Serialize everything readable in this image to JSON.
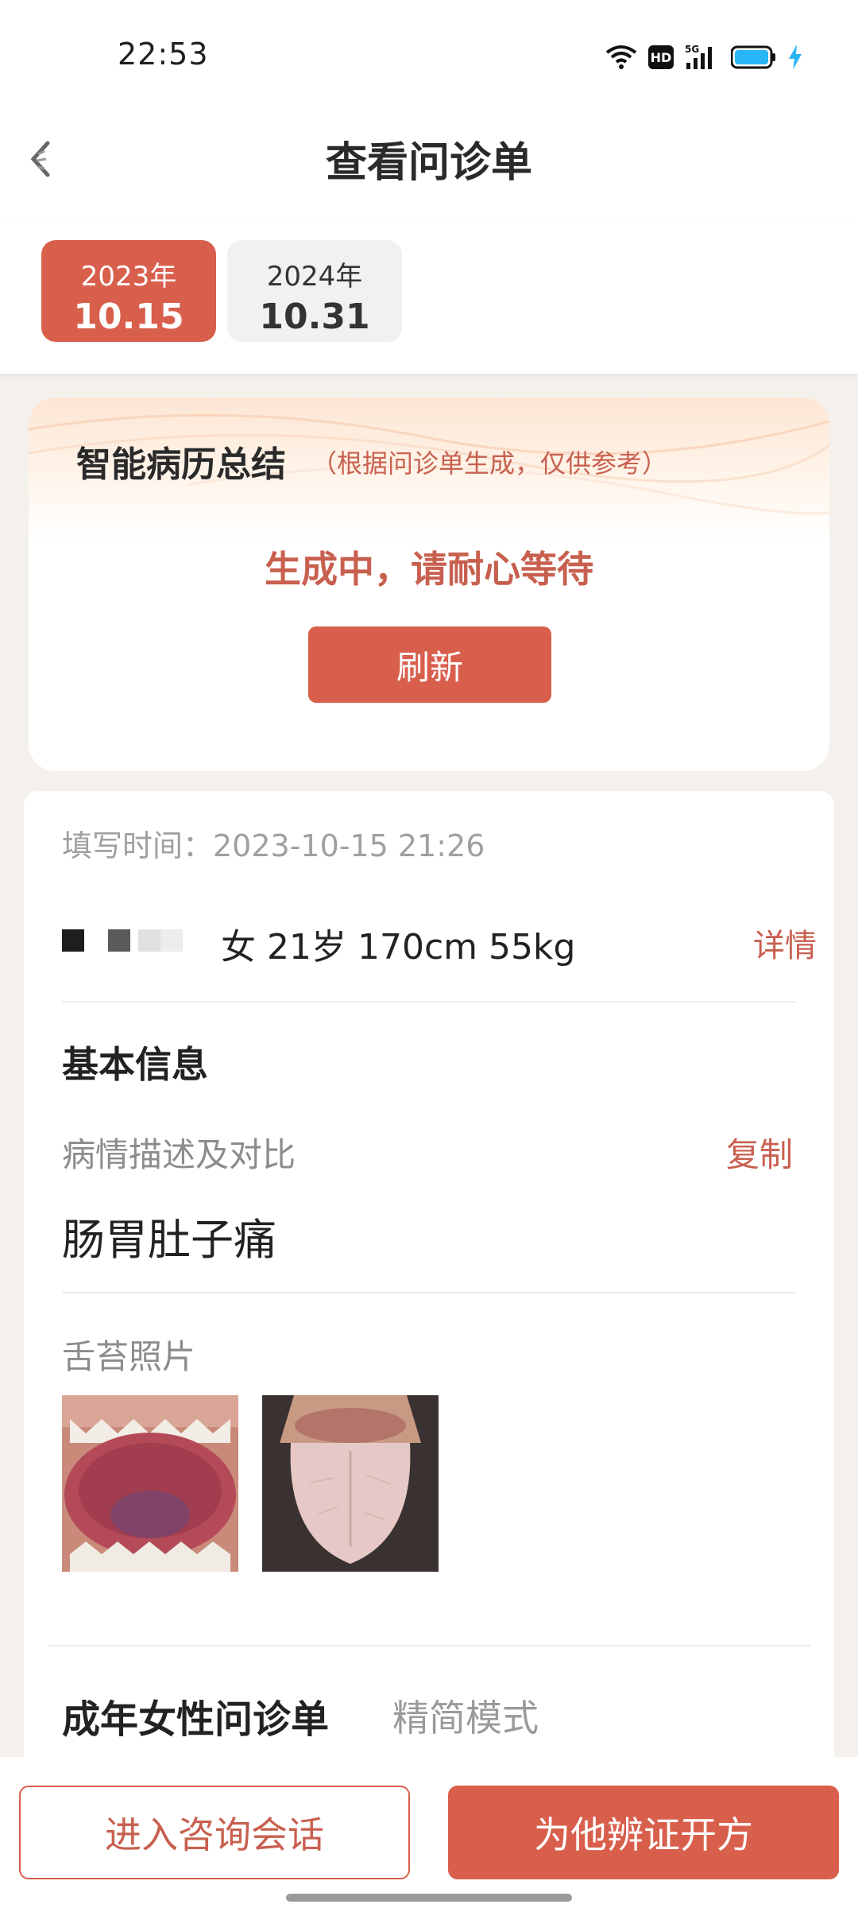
{
  "status_bar": {
    "time": "22:53",
    "hd_badge": "HD",
    "network": "5G",
    "icons": [
      "wifi-icon",
      "hd-icon",
      "signal-5g-icon",
      "battery-icon",
      "charging-bolt-icon"
    ],
    "battery_color": "#29b6f6"
  },
  "header": {
    "title": "查看问诊单",
    "back_icon": "back-arrow-icon"
  },
  "date_tabs": [
    {
      "year": "2023年",
      "day": "10.15",
      "active": true
    },
    {
      "year": "2024年",
      "day": "10.31",
      "active": false
    }
  ],
  "ai_summary": {
    "title": "智能病历总结",
    "subtitle": "（根据问诊单生成，仅供参考）",
    "status": "生成中，请耐心等待",
    "refresh_label": "刷新"
  },
  "record": {
    "fill_time": "填写时间：2023-10-15 21:26",
    "patient_info": "女 21岁 170cm 55kg",
    "detail_label": "详情",
    "section_title": "基本信息",
    "description_label": "病情描述及对比",
    "copy_label": "复制",
    "description_text": "肠胃肚子痛",
    "photo_label": "舌苔照片",
    "photos": [
      "tongue-photo-1",
      "tongue-photo-2"
    ],
    "form_title": "成年女性问诊单",
    "mode_label": "精简模式"
  },
  "bottom_actions": {
    "consult_label": "进入咨询会话",
    "prescribe_label": "为他辨证开方"
  },
  "colors": {
    "accent": "#d95f4d",
    "accent_text": "#c8604f",
    "background": "#f4f1ec",
    "muted_text": "#8c8c8c"
  }
}
